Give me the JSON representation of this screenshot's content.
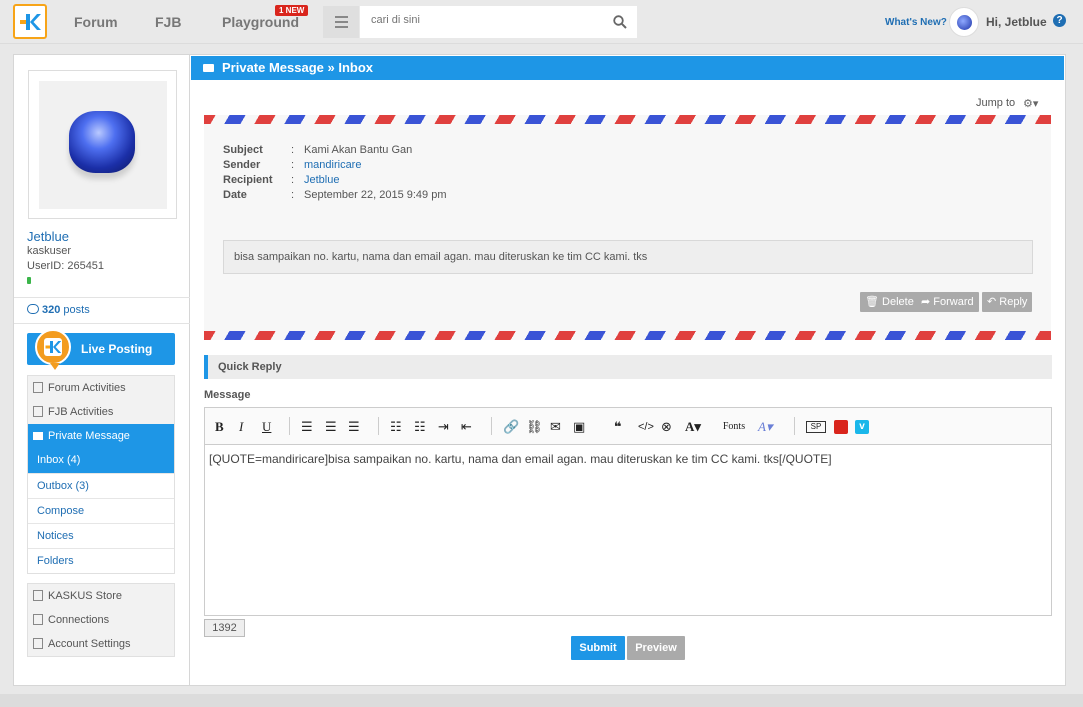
{
  "nav": {
    "forum": "Forum",
    "fjb": "FJB",
    "playground": "Playground",
    "new_badge": "1 NEW",
    "search_placeholder": "cari di sini",
    "whats_new": "What's New?",
    "greeting": "Hi, Jetblue",
    "help": "?"
  },
  "profile": {
    "username": "Jetblue",
    "rank": "kaskuser",
    "user_id": "UserID: 265451",
    "posts_count": "320",
    "posts_label": "posts"
  },
  "live_posting": "Live Posting",
  "sidebar": {
    "items": [
      {
        "label": "Forum Activities"
      },
      {
        "label": "FJB Activities"
      },
      {
        "label": "Private Message"
      }
    ],
    "pm_sub": [
      {
        "label": "Inbox (4)"
      },
      {
        "label": "Outbox (3)"
      },
      {
        "label": "Compose"
      },
      {
        "label": "Notices"
      },
      {
        "label": "Folders"
      }
    ],
    "bottom": [
      {
        "label": "KASKUS Store"
      },
      {
        "label": "Connections"
      },
      {
        "label": "Account Settings"
      }
    ]
  },
  "content": {
    "title": "Private Message » Inbox",
    "jump_to": "Jump to",
    "message": {
      "subject_label": "Subject",
      "subject": "Kami Akan Bantu Gan",
      "sender_label": "Sender",
      "sender": "mandiricare",
      "recipient_label": "Recipient",
      "recipient": "Jetblue",
      "date_label": "Date",
      "date": "September 22, 2015 9:49 pm",
      "body": "bisa sampaikan no. kartu, nama dan email agan. mau diteruskan ke tim CC kami. tks"
    },
    "actions": {
      "delete": "Delete",
      "forward": "Forward",
      "reply": "Reply"
    },
    "quick_reply": "Quick Reply",
    "message_label": "Message",
    "editor_text": "[QUOTE=mandiricare]bisa sampaikan no. kartu, nama dan email agan. mau diteruskan ke tim CC kami. tks[/QUOTE]",
    "fonts_label": "Fonts",
    "char_count": "1392",
    "submit": "Submit",
    "preview": "Preview"
  },
  "colors": {
    "accent": "#1e96e6",
    "logo_border": "#f7a418",
    "link": "#1f6eb3",
    "stripe_red": "#e0403e",
    "stripe_blue": "#3a54d6"
  }
}
